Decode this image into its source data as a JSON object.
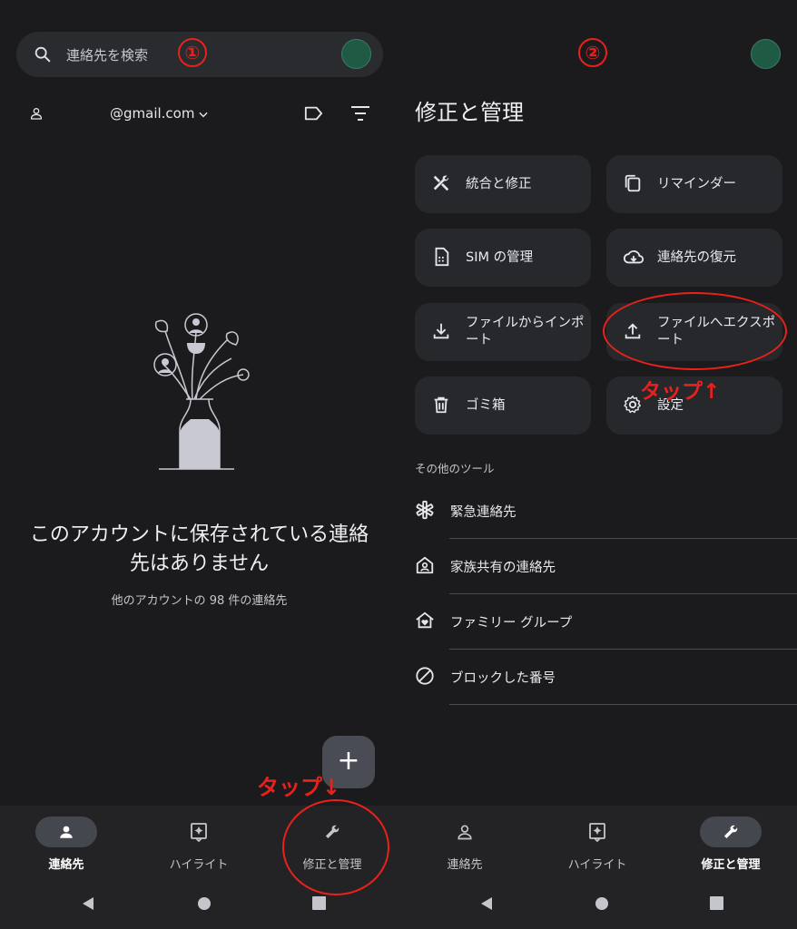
{
  "left": {
    "search": {
      "placeholder": "連絡先を検索",
      "marker": "①"
    },
    "account": {
      "email": "@gmail.com"
    },
    "empty": {
      "title_line1": "このアカウントに保存されている連絡",
      "title_line2": "先はありません",
      "subtitle": "他のアカウントの 98 件の連絡先"
    },
    "fab_label": "+",
    "annotation_tap": "タップ↓",
    "nav": [
      {
        "label": "連絡先",
        "active": true,
        "icon": "person-icon"
      },
      {
        "label": "ハイライト",
        "active": false,
        "icon": "highlight-icon"
      },
      {
        "label": "修正と管理",
        "active": false,
        "icon": "wrench-icon"
      }
    ]
  },
  "right": {
    "marker": "②",
    "title": "修正と管理",
    "tiles": [
      {
        "label": "統合と修正",
        "icon": "tools-icon"
      },
      {
        "label": "リマインダー",
        "icon": "copy-icon"
      },
      {
        "label": "SIM の管理",
        "icon": "sim-card-icon"
      },
      {
        "label": "連絡先の復元",
        "icon": "cloud-restore-icon"
      },
      {
        "label": "ファイルからインポート",
        "icon": "download-icon"
      },
      {
        "label": "ファイルへエクスポート",
        "icon": "upload-icon"
      },
      {
        "label": "ゴミ箱",
        "icon": "trash-icon"
      },
      {
        "label": "設定",
        "icon": "gear-icon"
      }
    ],
    "section_label": "その他のツール",
    "tools": [
      {
        "label": "緊急連絡先",
        "icon": "asterisk-icon"
      },
      {
        "label": "家族共有の連絡先",
        "icon": "home-person-icon"
      },
      {
        "label": "ファミリー グループ",
        "icon": "home-heart-icon"
      },
      {
        "label": "ブロックした番号",
        "icon": "block-icon"
      }
    ],
    "annotation_tap": "タップ↑",
    "nav": [
      {
        "label": "連絡先",
        "active": false,
        "icon": "person-icon"
      },
      {
        "label": "ハイライト",
        "active": false,
        "icon": "highlight-icon"
      },
      {
        "label": "修正と管理",
        "active": true,
        "icon": "wrench-icon"
      }
    ]
  },
  "colors": {
    "background": "#1b1b1d",
    "accent_annotation": "#e8211c",
    "avatar": "#1f5a45"
  }
}
